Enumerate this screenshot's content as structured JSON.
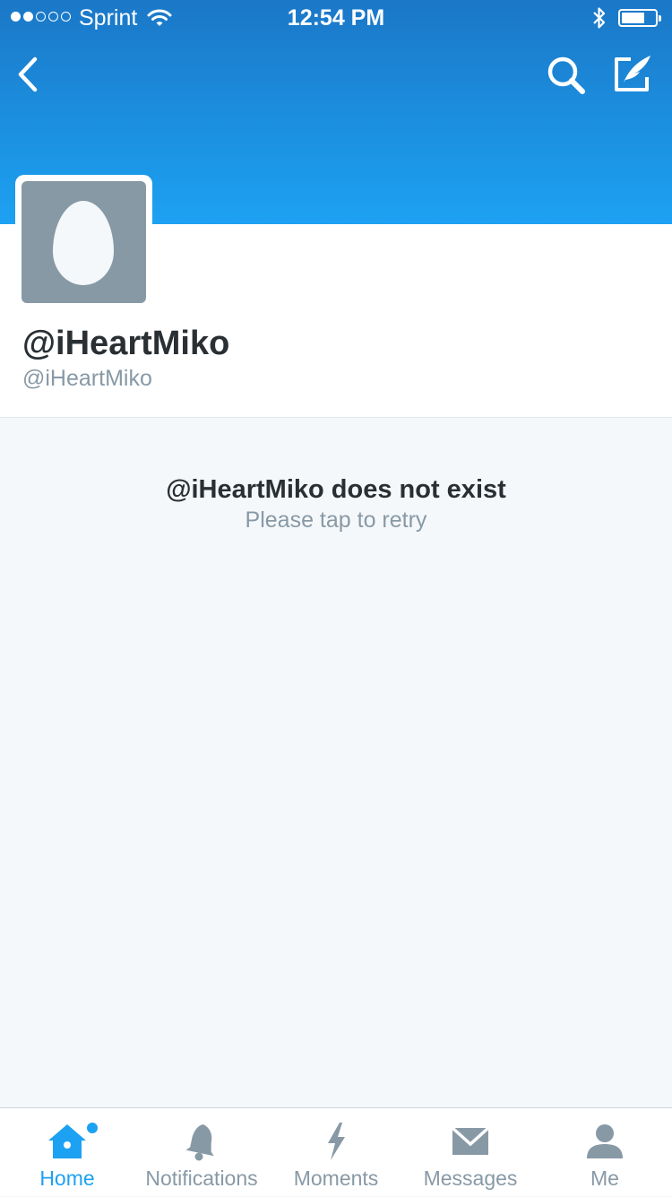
{
  "status_bar": {
    "carrier": "Sprint",
    "time": "12:54 PM",
    "signal_strength": "2 of 5 dots",
    "battery_level": 0.7
  },
  "nav": {
    "back_icon": "chevron-left-icon",
    "search_icon": "search-icon",
    "compose_icon": "compose-tweet-icon"
  },
  "profile": {
    "display_name": "@iHeartMiko",
    "handle": "@iHeartMiko",
    "avatar": "default-egg-avatar"
  },
  "error": {
    "title": "@iHeartMiko does not exist",
    "subtitle": "Please tap to retry"
  },
  "tabs": [
    {
      "label": "Home",
      "icon": "home-icon",
      "active": true,
      "has_badge": true
    },
    {
      "label": "Notifications",
      "icon": "bell-icon",
      "active": false
    },
    {
      "label": "Moments",
      "icon": "lightning-icon",
      "active": false
    },
    {
      "label": "Messages",
      "icon": "envelope-icon",
      "active": false
    },
    {
      "label": "Me",
      "icon": "person-icon",
      "active": false
    }
  ],
  "colors": {
    "brand_blue": "#1da1f2",
    "header_top": "#1b77c7",
    "background": "#f5f8fa",
    "text_dark": "#292f33",
    "text_gray": "#8899a6"
  }
}
